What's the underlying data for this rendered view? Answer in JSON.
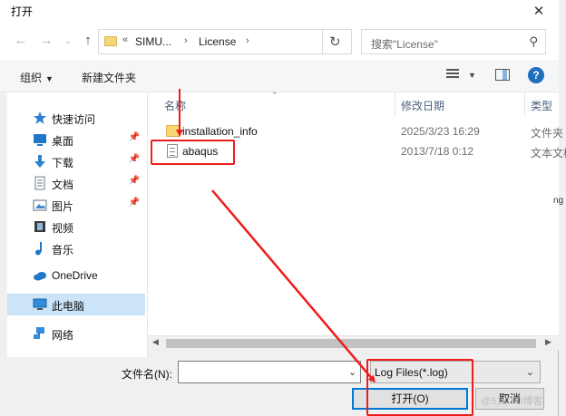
{
  "window": {
    "title": "打开",
    "close_glyph": "✕"
  },
  "nav": {
    "back_glyph": "←",
    "forward_glyph": "→",
    "recent_glyph": "⌄",
    "up_glyph": "↑",
    "breadcrumb_prefix": "«",
    "breadcrumb": [
      "SIMU...",
      "License"
    ],
    "crumb_sep": "›",
    "refresh_glyph": "↻",
    "search_placeholder": "搜索\"License\"",
    "search_glyph": "⚲"
  },
  "toolbar": {
    "organize_label": "组织",
    "organize_caret": "▼",
    "new_folder_label": "新建文件夹",
    "view_caret": "▼",
    "help_label": "?"
  },
  "sidebar": {
    "items": [
      {
        "label": "快速访问",
        "icon": "star-icon",
        "pinned": false
      },
      {
        "label": "桌面",
        "icon": "desktop-icon",
        "pinned": true
      },
      {
        "label": "下载",
        "icon": "download-icon",
        "pinned": true
      },
      {
        "label": "文档",
        "icon": "documents-icon",
        "pinned": true
      },
      {
        "label": "图片",
        "icon": "pictures-icon",
        "pinned": true
      },
      {
        "label": "视频",
        "icon": "video-icon",
        "pinned": false
      },
      {
        "label": "音乐",
        "icon": "music-icon",
        "pinned": false
      },
      {
        "label": "OneDrive",
        "icon": "cloud-icon",
        "pinned": false
      },
      {
        "label": "此电脑",
        "icon": "pc-icon",
        "pinned": false,
        "selected": true
      },
      {
        "label": "网络",
        "icon": "network-icon",
        "pinned": false
      }
    ],
    "pin_glyph": "📌"
  },
  "filelist": {
    "columns": {
      "name": "名称",
      "date": "修改日期",
      "type": "类型"
    },
    "sort_glyph": "⌃",
    "rows": [
      {
        "name": "installation_info",
        "date": "2025/3/23 16:29",
        "type": "文件夹",
        "icon": "folder-icon"
      },
      {
        "name": "abaqus",
        "date": "2013/7/18 0:12",
        "type": "文本文档",
        "icon": "text-file-icon"
      }
    ]
  },
  "scroll": {
    "left_glyph": "◀",
    "right_glyph": "▶"
  },
  "footer": {
    "filename_label": "文件名(N):",
    "filename_value": "",
    "filename_caret": "⌄",
    "filter_value": "Log Files(*.log)",
    "filter_caret": "⌄",
    "open_label": "打开(O)",
    "cancel_label": "取消"
  },
  "watermark": "@51CTO博客",
  "edge_text": "ng",
  "annotation_color": "#ee1c1c"
}
